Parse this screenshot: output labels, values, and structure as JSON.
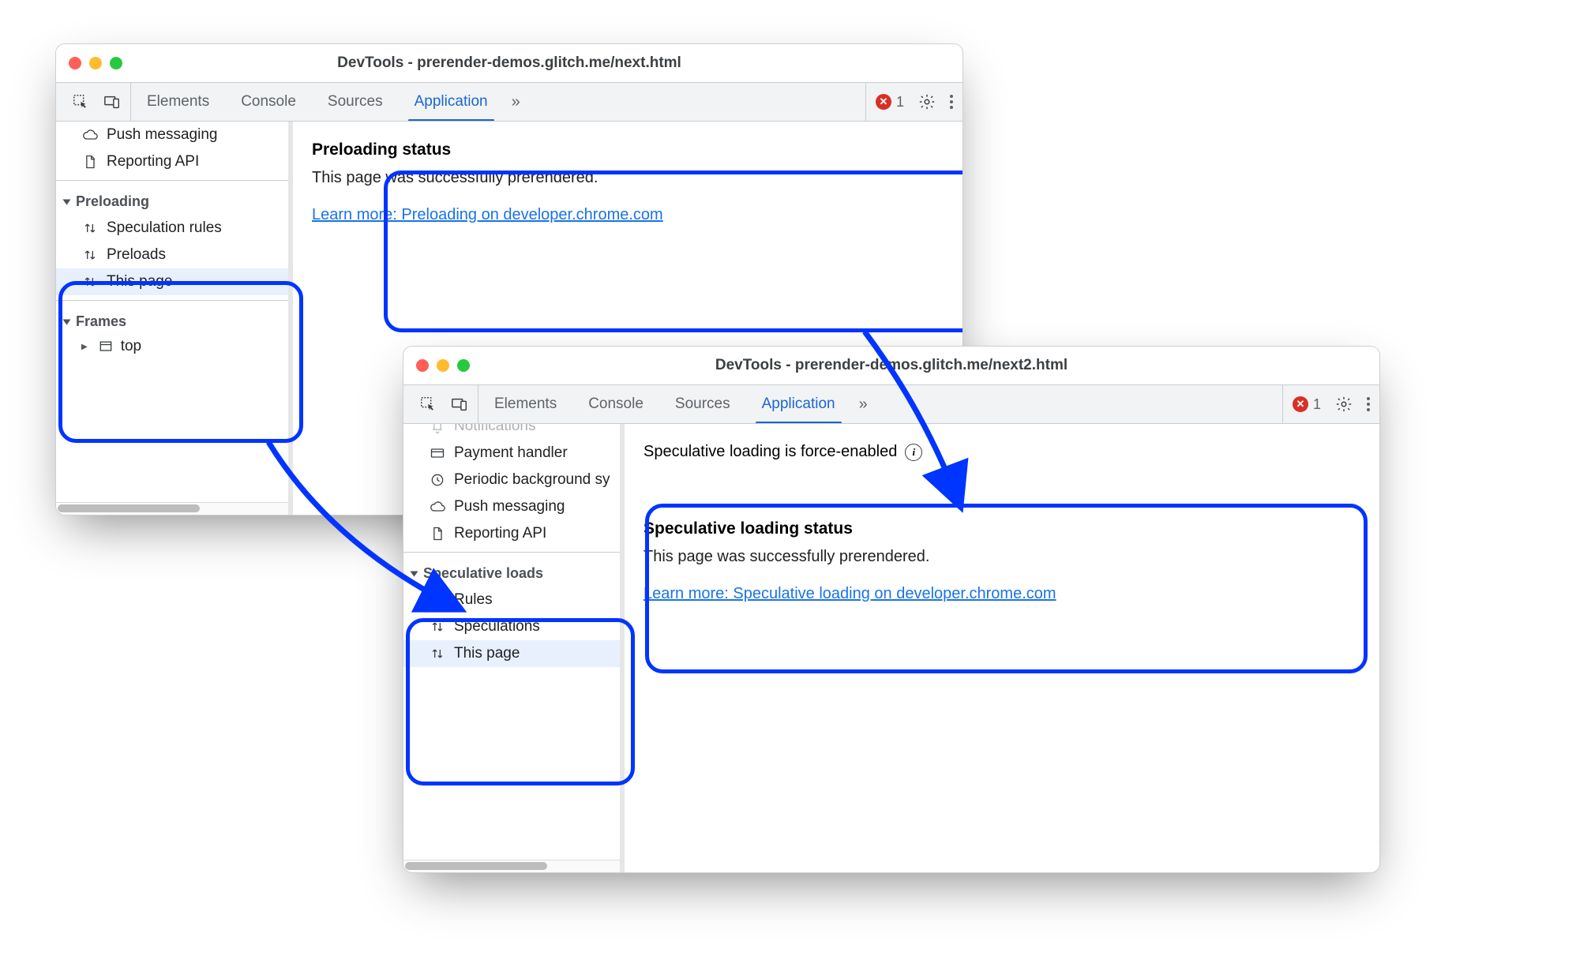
{
  "windowA": {
    "title": "DevTools - prerender-demos.glitch.me/next.html",
    "tabs": [
      "Elements",
      "Console",
      "Sources",
      "Application"
    ],
    "activeTab": "Application",
    "errorCount": "1",
    "sidebar": {
      "top": [
        {
          "icon": "cloud",
          "label": "Push messaging"
        },
        {
          "icon": "file",
          "label": "Reporting API"
        }
      ],
      "sectionA": {
        "title": "Preloading",
        "items": [
          {
            "label": "Speculation rules"
          },
          {
            "label": "Preloads"
          },
          {
            "label": "This page",
            "selected": true
          }
        ]
      },
      "sectionB": {
        "title": "Frames",
        "items": [
          {
            "label": "top"
          }
        ]
      }
    },
    "panel": {
      "title": "Preloading status",
      "text": "This page was successfully prerendered.",
      "link": "Learn more: Preloading on developer.chrome.com"
    }
  },
  "windowB": {
    "title": "DevTools - prerender-demos.glitch.me/next2.html",
    "tabs": [
      "Elements",
      "Console",
      "Sources",
      "Application"
    ],
    "activeTab": "Application",
    "errorCount": "1",
    "statusline": "Speculative loading is force-enabled",
    "sidebar": {
      "top": [
        {
          "icon": "bell",
          "label": "Notifications",
          "clipped": true
        },
        {
          "icon": "card",
          "label": "Payment handler"
        },
        {
          "icon": "clock",
          "label": "Periodic background sy"
        },
        {
          "icon": "cloud",
          "label": "Push messaging"
        },
        {
          "icon": "file",
          "label": "Reporting API"
        }
      ],
      "sectionA": {
        "title": "Speculative loads",
        "items": [
          {
            "label": "Rules"
          },
          {
            "label": "Speculations"
          },
          {
            "label": "This page",
            "selected": true
          }
        ]
      }
    },
    "panel": {
      "title": "Speculative loading status",
      "text": "This page was successfully prerendered.",
      "link": "Learn more: Speculative loading on developer.chrome.com"
    }
  }
}
